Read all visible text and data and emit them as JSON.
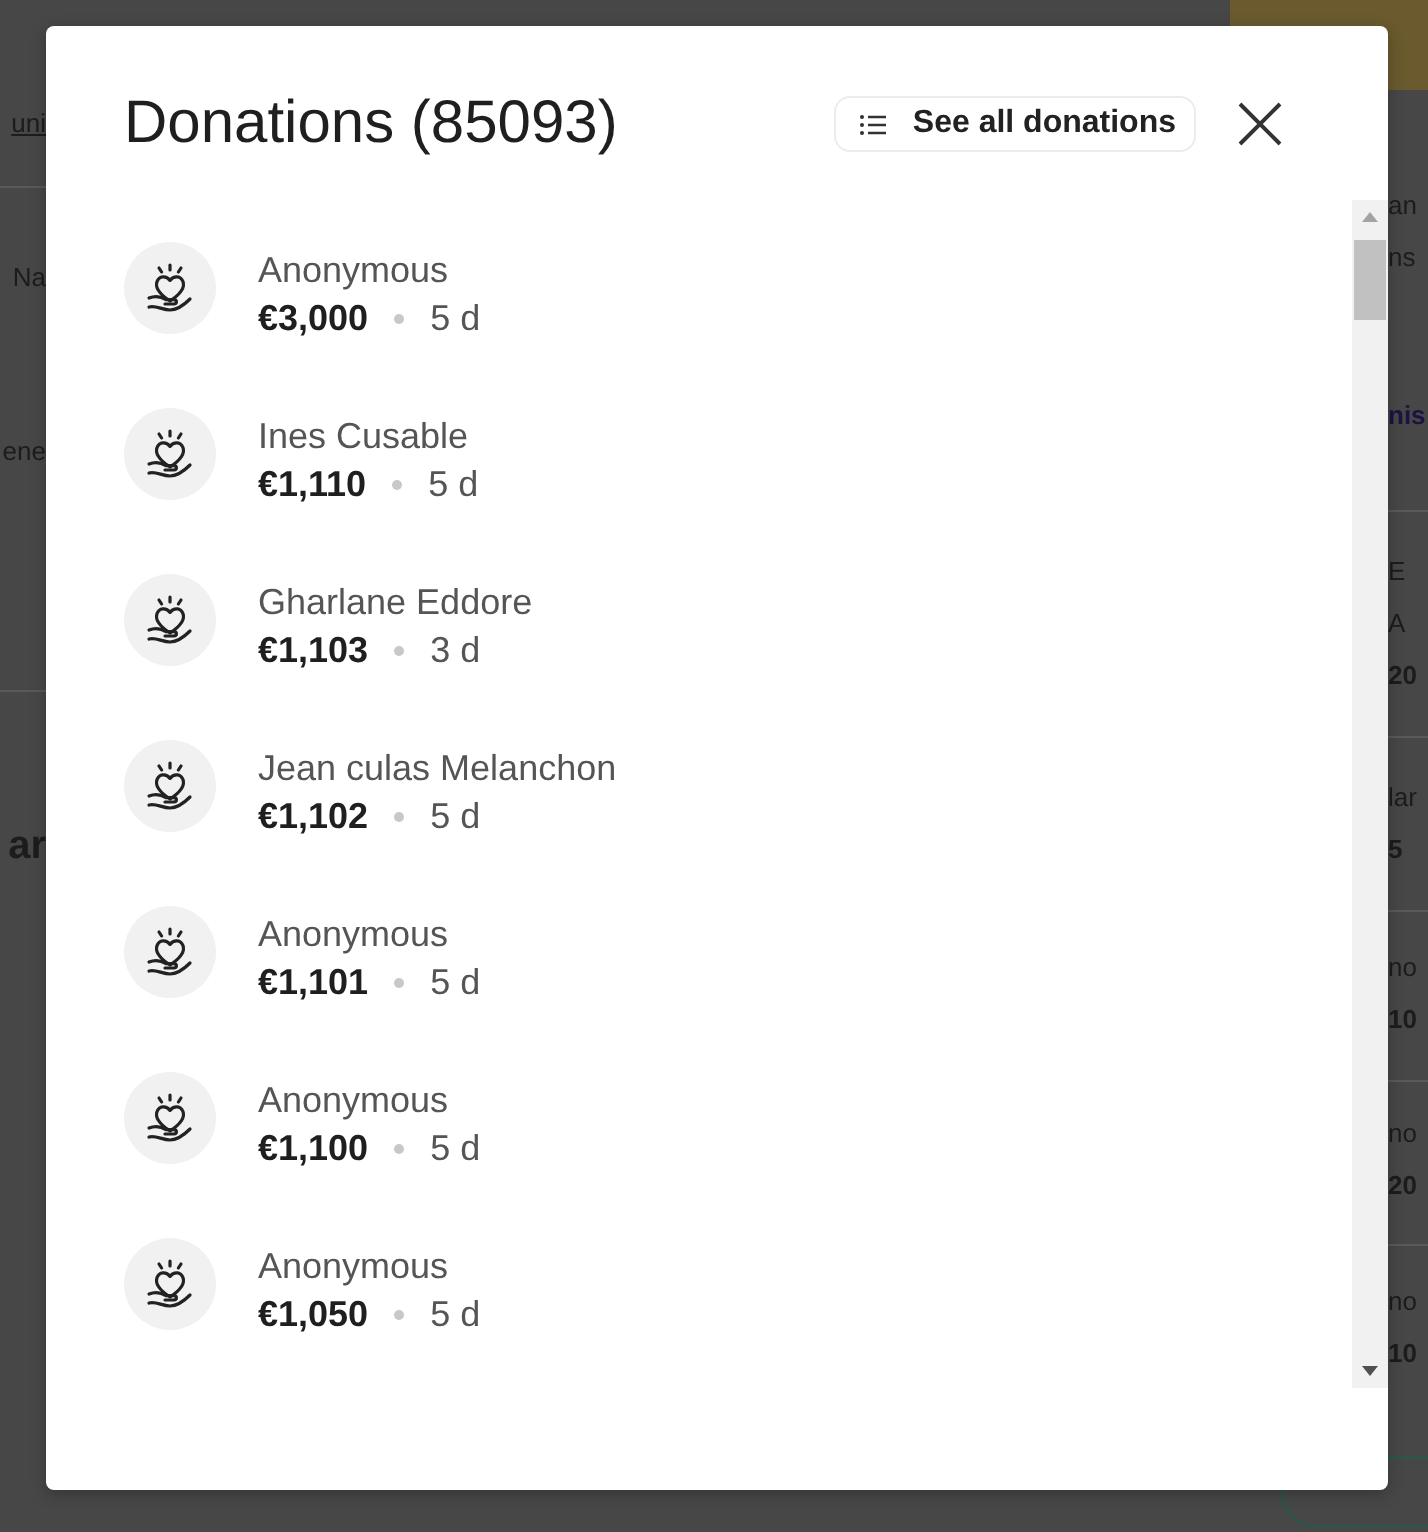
{
  "background_page": {
    "left_column": [
      {
        "texts": [
          {
            "text": "uni",
            "kind": "link"
          }
        ]
      },
      {
        "texts": [
          {
            "text": "Na",
            "kind": "plain"
          },
          {
            "text": "ene",
            "kind": "plain"
          }
        ]
      },
      {
        "texts": [
          {
            "text": "ar",
            "kind": "heading"
          }
        ]
      }
    ],
    "right_column": [
      {
        "texts": [
          {
            "text": "an",
            "kind": "plain"
          },
          {
            "text": "ns",
            "kind": "plain"
          },
          {
            "text": "nis",
            "kind": "accent"
          }
        ]
      },
      {
        "texts": [
          {
            "text": "E",
            "kind": "plain"
          },
          {
            "text": "A",
            "kind": "plain"
          },
          {
            "text": "20",
            "kind": "bold"
          }
        ]
      },
      {
        "texts": [
          {
            "text": "lar",
            "kind": "plain"
          },
          {
            "text": "5",
            "kind": "bold"
          }
        ]
      },
      {
        "texts": [
          {
            "text": "no",
            "kind": "plain"
          },
          {
            "text": "10",
            "kind": "bold"
          }
        ]
      },
      {
        "texts": [
          {
            "text": "no",
            "kind": "plain"
          },
          {
            "text": "20",
            "kind": "bold"
          }
        ]
      },
      {
        "texts": [
          {
            "text": "no",
            "kind": "plain"
          },
          {
            "text": "10",
            "kind": "bold"
          }
        ]
      }
    ]
  },
  "dialog": {
    "title": "Donations (85093)",
    "see_all_button": "See all donations",
    "donations": [
      {
        "name": "Anonymous",
        "amount": "€3,000",
        "time": "5 d"
      },
      {
        "name": "Ines Cusable",
        "amount": "€1,110",
        "time": "5 d"
      },
      {
        "name": "Gharlane Eddore",
        "amount": "€1,103",
        "time": "3 d"
      },
      {
        "name": "Jean culas Melanchon",
        "amount": "€1,102",
        "time": "5 d"
      },
      {
        "name": "Anonymous",
        "amount": "€1,101",
        "time": "5 d"
      },
      {
        "name": "Anonymous",
        "amount": "€1,100",
        "time": "5 d"
      },
      {
        "name": "Anonymous",
        "amount": "€1,050",
        "time": "5 d"
      }
    ]
  }
}
